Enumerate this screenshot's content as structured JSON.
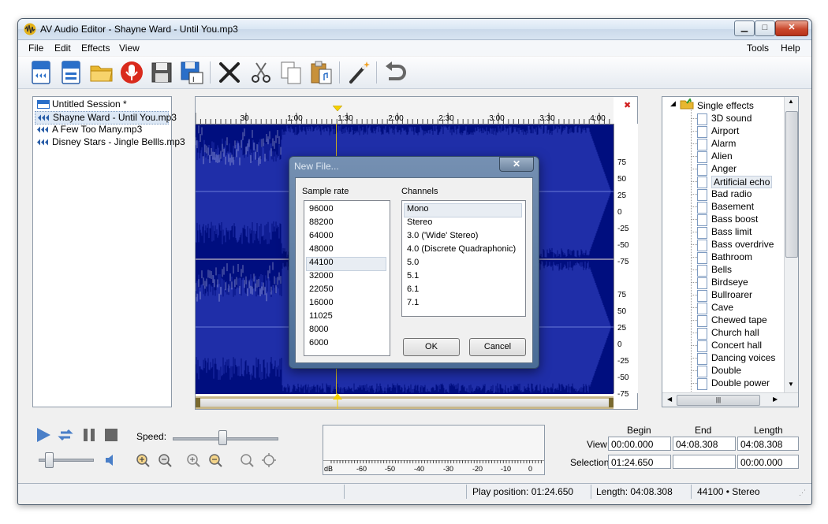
{
  "window": {
    "title": "AV Audio Editor - Shayne Ward -  Until You.mp3",
    "icons": {
      "app": "waveform-logo-icon",
      "minimize": "minimize-icon",
      "maximize": "maximize-icon",
      "close": "close-icon"
    }
  },
  "menu": {
    "left": [
      "File",
      "Edit",
      "Effects",
      "View"
    ],
    "right": [
      "Tools",
      "Help"
    ]
  },
  "toolbar": {
    "icons": [
      "new-session-icon",
      "new-file-icon",
      "open-folder-icon",
      "record-icon",
      "save-icon",
      "save-as-icon",
      "delete-icon",
      "cut-icon",
      "copy-icon",
      "paste-icon",
      "magic-wand-icon",
      "undo-icon"
    ]
  },
  "file_list": {
    "items": [
      {
        "label": "Untitled Session *",
        "icon": "session-icon",
        "selected": false
      },
      {
        "label": "Shayne Ward -  Until You.mp3",
        "icon": "audio-file-icon",
        "selected": true
      },
      {
        "label": "A Few Too Many.mp3",
        "icon": "audio-file-icon",
        "selected": false
      },
      {
        "label": "Disney Stars - Jingle Bellls.mp3",
        "icon": "audio-file-icon",
        "selected": false
      }
    ]
  },
  "waveform": {
    "time_ticks": [
      "30",
      "1:00",
      "1:30",
      "2:00",
      "2:30",
      "3:00",
      "3:30",
      "4:00"
    ],
    "amp_ticks_top": [
      "75",
      "50",
      "25",
      "0",
      "-25",
      "-50",
      "-75"
    ],
    "amp_ticks_bottom": [
      "75",
      "50",
      "25",
      "0",
      "-25",
      "-50",
      "-75"
    ],
    "close_glyph": "✖",
    "colors": {
      "wave": "#000e7f",
      "marker": "#f5d000"
    }
  },
  "effects": {
    "root": "Single effects",
    "items": [
      "3D sound",
      "Airport",
      "Alarm",
      "Alien",
      "Anger",
      "Artificial echo",
      "Bad radio",
      "Basement",
      "Bass boost",
      "Bass limit",
      "Bass overdrive",
      "Bathroom",
      "Bells",
      "Birdseye",
      "Bullroarer",
      "Cave",
      "Chewed tape",
      "Church hall",
      "Concert hall",
      "Dancing voices",
      "Double",
      "Double power"
    ],
    "selected": "Artificial echo",
    "scroll_thumb": "|||"
  },
  "playback": {
    "speed_label": "Speed:",
    "icons": [
      "play-icon",
      "loop-icon",
      "pause-icon",
      "stop-icon",
      "volume-icon",
      "zoom-in-h-icon",
      "zoom-out-h-icon",
      "zoom-in-v-icon",
      "zoom-out-v-icon",
      "zoom-selection-icon",
      "zoom-fit-icon"
    ]
  },
  "meter": {
    "labels": [
      "dB",
      "-60",
      "-50",
      "-40",
      "-30",
      "-20",
      "-10",
      "0"
    ]
  },
  "selection_info": {
    "headers": [
      "Begin",
      "End",
      "Length"
    ],
    "view_label": "View",
    "selection_label": "Selection",
    "view": [
      "00:00.000",
      "04:08.308",
      "04:08.308"
    ],
    "selection": [
      "01:24.650",
      "",
      "00:00.000"
    ]
  },
  "status": {
    "play_position": "Play position: 01:24.650",
    "length": "Length: 04:08.308",
    "format": "44100 • Stereo"
  },
  "dialog": {
    "title": "New File...",
    "close_glyph": "✕",
    "sample_rate_label": "Sample rate",
    "channels_label": "Channels",
    "sample_rates": [
      "96000",
      "88200",
      "64000",
      "48000",
      "44100",
      "32000",
      "22050",
      "16000",
      "11025",
      "8000",
      "6000"
    ],
    "selected_rate": "44100",
    "channels": [
      "Mono",
      "Stereo",
      "3.0 ('Wide' Stereo)",
      "4.0 (Discrete Quadraphonic)",
      "5.0",
      "5.1",
      "6.1",
      "7.1"
    ],
    "selected_channel": "Mono",
    "ok_label": "OK",
    "cancel_label": "Cancel"
  }
}
